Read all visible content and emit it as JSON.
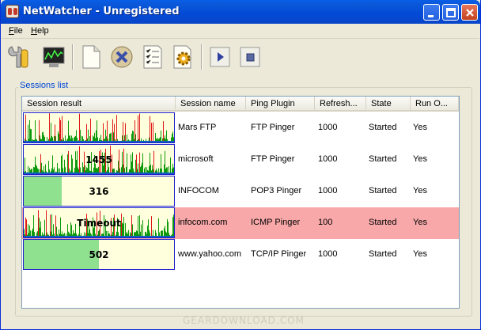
{
  "window": {
    "title": "NetWatcher - Unregistered"
  },
  "menu": [
    {
      "underline": "F",
      "rest": "ile"
    },
    {
      "underline": "H",
      "rest": "elp"
    }
  ],
  "toolbar": [
    {
      "name": "properties-tool-icon"
    },
    {
      "name": "monitor-chart-icon"
    },
    {
      "name": "new-session-icon"
    },
    {
      "name": "delete-session-icon"
    },
    {
      "name": "session-list-icon"
    },
    {
      "name": "settings-gear-icon"
    },
    {
      "name": "start-play-icon"
    },
    {
      "name": "stop-icon"
    }
  ],
  "sessions_group": {
    "label": "Sessions list"
  },
  "columns": [
    "Session result",
    "Session name",
    "Ping Plugin",
    "Refresh...",
    "State",
    "Run O..."
  ],
  "rows": [
    {
      "graph_label": "",
      "graph_type": "chart",
      "name": "Mars FTP",
      "plugin": "FTP Pinger",
      "refresh": "1000",
      "state": "Started",
      "run": "Yes",
      "alert": false
    },
    {
      "graph_label": "1455",
      "graph_type": "chart",
      "name": "microsoft",
      "plugin": "FTP Pinger",
      "refresh": "1000",
      "state": "Started",
      "run": "Yes",
      "alert": false
    },
    {
      "graph_label": "316",
      "graph_type": "bar",
      "fill": 0.25,
      "name": "INFOCOM",
      "plugin": "POP3 Pinger",
      "refresh": "1000",
      "state": "Started",
      "run": "Yes",
      "alert": false
    },
    {
      "graph_label": "Timeout",
      "graph_type": "chart",
      "name": "infocom.com",
      "plugin": "ICMP Pinger",
      "refresh": "100",
      "state": "Started",
      "run": "Yes",
      "alert": true
    },
    {
      "graph_label": "502",
      "graph_type": "bar",
      "fill": 0.5,
      "name": "www.yahoo.com",
      "plugin": "TCP/IP Pinger",
      "refresh": "1000",
      "state": "Started",
      "run": "Yes",
      "alert": false
    }
  ],
  "colors": {
    "title_bar": "#0349d6",
    "alert_row": "#f8a8a8",
    "graph_bg": "#ffffdd",
    "bar_green": "#8fe08f",
    "spike_green": "#0c9a0c",
    "spike_red": "#e01818"
  },
  "watermark": "GEARDOWNLOAD.COM"
}
